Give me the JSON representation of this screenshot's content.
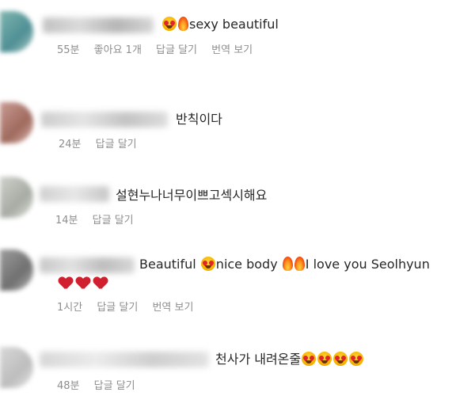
{
  "comments": [
    {
      "text_after_emoji": "sexy beautiful",
      "time": "55분",
      "likes": "좋아요 1개",
      "reply": "답글 달기",
      "translate": "번역 보기"
    },
    {
      "text": "반칙이다",
      "time": "24분",
      "reply": "답글 달기"
    },
    {
      "text": "설현누나너무이쁘고섹시해요",
      "time": "14분",
      "reply": "답글 달기"
    },
    {
      "text_1": "Beautiful",
      "text_2": "nice body",
      "text_3": "I love you Seolhyun",
      "time": "1시간",
      "reply": "답글 달기",
      "translate": "번역 보기"
    },
    {
      "text": "천사가 내려온줄",
      "time": "48분",
      "reply": "답글 달기"
    }
  ],
  "icons": [
    "heart-eyes-emoji",
    "fire-emoji",
    "heart-emoji"
  ],
  "colors": {
    "text": "#262626",
    "meta": "#8e8e8e",
    "emoji_face": "#f7b500",
    "heart": "#d01f2f"
  }
}
